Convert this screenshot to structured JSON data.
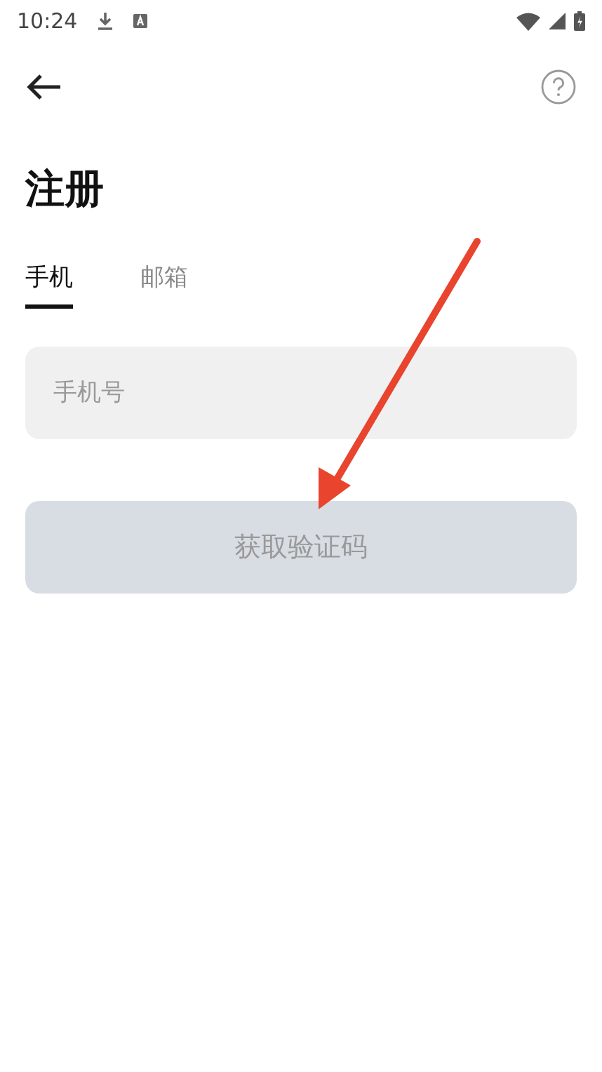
{
  "status_bar": {
    "time": "10:24"
  },
  "title": "注册",
  "tabs": [
    {
      "label": "手机",
      "selected": true
    },
    {
      "label": "邮箱",
      "selected": false
    }
  ],
  "phone_field": {
    "placeholder": "手机号"
  },
  "submit_button": {
    "label": "获取验证码",
    "disabled": true
  }
}
